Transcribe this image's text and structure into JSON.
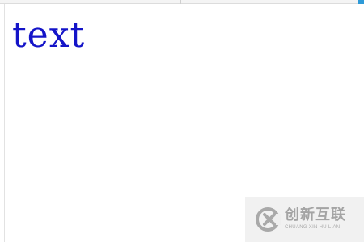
{
  "document": {
    "text": "text",
    "text_color": "#1414c8"
  },
  "watermark": {
    "brand_cn": "创新互联",
    "brand_en": "CHUANG XIN HU LIAN",
    "logo_icon": "x-circle-logo-icon"
  },
  "colors": {
    "accent": "#2e9ad8",
    "watermark_bg": "#eeeeee",
    "watermark_text": "#a4a4a4"
  }
}
